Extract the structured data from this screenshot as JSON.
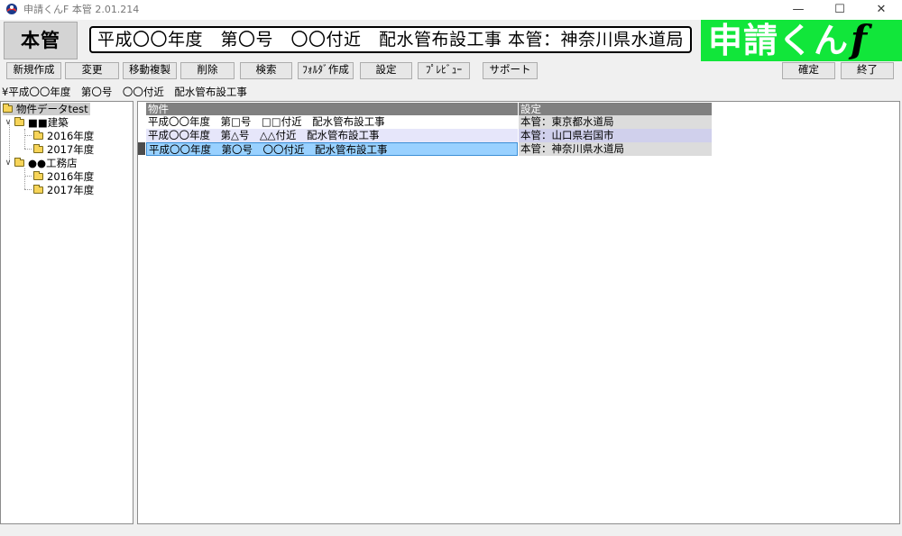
{
  "window": {
    "title": "申請くんF 本管 2.01.214",
    "controls": {
      "minimize": "—",
      "maximize": "☐",
      "close": "✕"
    }
  },
  "header": {
    "mode_label": "本管",
    "title": "平成〇〇年度　第〇号　〇〇付近　配水管布設工事 本管：神奈川県水道局",
    "logo_text": "申請くん",
    "logo_suffix": "f"
  },
  "colors": {
    "logo_bg": "#11e63a",
    "row_alt": "#e6e6fa",
    "row_selected": "#99d1ff",
    "header_bg": "#808080"
  },
  "toolbar": {
    "new": "新規作成",
    "edit": "変更",
    "move_copy": "移動複製",
    "delete": "削除",
    "search": "検索",
    "folder_create": "ﾌｫﾙﾀﾞ作成",
    "settings": "設定",
    "preview": "ﾌﾟﾚﾋﾞｭｰ",
    "support": "サポート",
    "confirm": "確定",
    "exit": "終了"
  },
  "path": "¥平成〇〇年度　第〇号　〇〇付近　配水管布設工事",
  "tree": {
    "root": "物件データtest",
    "groups": [
      {
        "label": "■■建築",
        "children": [
          "2016年度",
          "2017年度"
        ]
      },
      {
        "label": "●●工務店",
        "children": [
          "2016年度",
          "2017年度"
        ]
      }
    ]
  },
  "list": {
    "columns": [
      "物件",
      "設定"
    ],
    "rows": [
      {
        "name": "平成〇〇年度　第□号　□□付近　配水管布設工事",
        "setting": "本管：東京都水道局"
      },
      {
        "name": "平成〇〇年度　第△号　△△付近　配水管布設工事",
        "setting": "本管：山口県岩国市"
      },
      {
        "name": "平成〇〇年度　第〇号　〇〇付近　配水管布設工事",
        "setting": "本管：神奈川県水道局"
      }
    ]
  }
}
